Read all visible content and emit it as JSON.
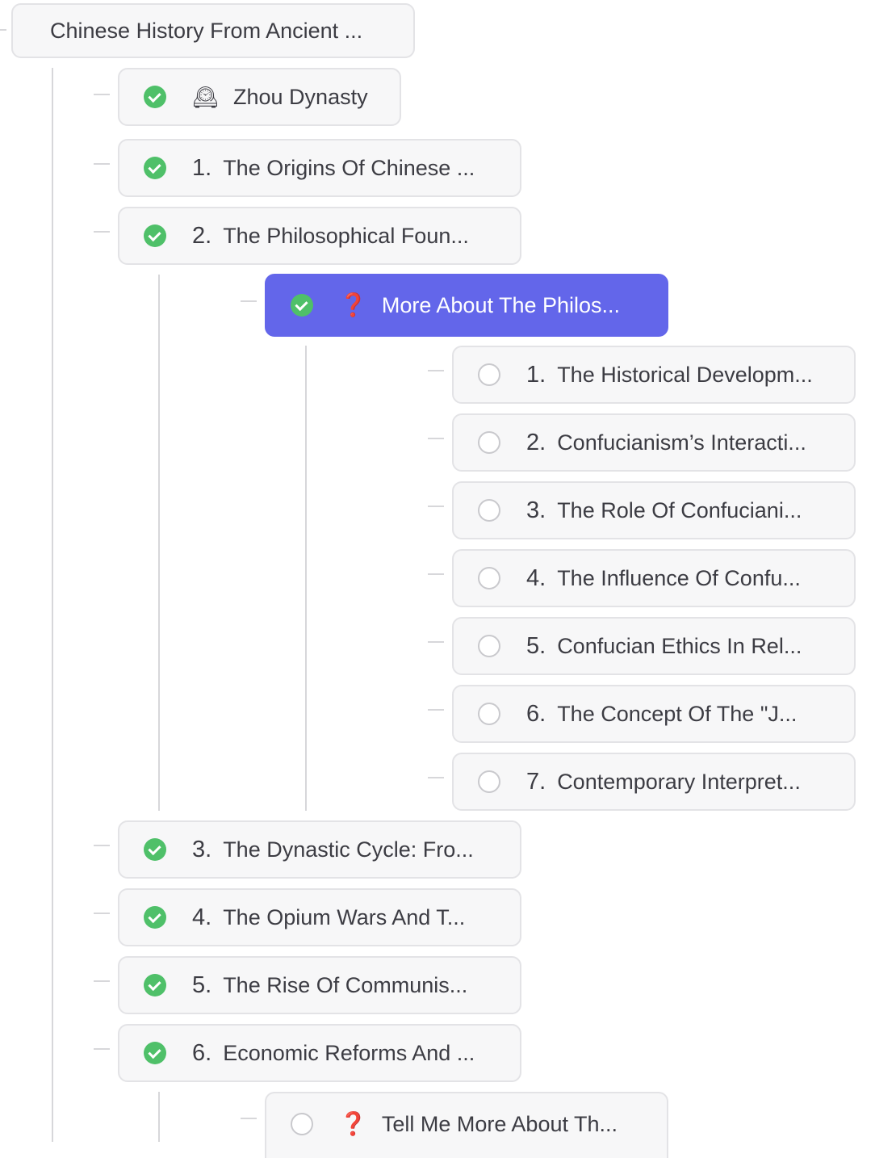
{
  "root": {
    "label": "Chinese History From Ancient ..."
  },
  "level1_top": [
    {
      "status": "done",
      "icon": "mantelpiece-clock-icon",
      "glyph": "🕰",
      "title": "Zhou Dynasty"
    },
    {
      "status": "done",
      "number": "1.",
      "title": "The Origins Of Chinese ..."
    },
    {
      "status": "done",
      "number": "2.",
      "title": "The Philosophical Foun..."
    }
  ],
  "level2_active": {
    "status": "done",
    "icon": "question-mark-icon",
    "glyph": "❓",
    "title": "More About The Philos..."
  },
  "level3": [
    {
      "status": "todo",
      "number": "1.",
      "title": "The Historical Developm..."
    },
    {
      "status": "todo",
      "number": "2.",
      "title": "Confucianism’s Interacti..."
    },
    {
      "status": "todo",
      "number": "3.",
      "title": "The Role Of Confuciani..."
    },
    {
      "status": "todo",
      "number": "4.",
      "title": "The Influence Of Confu..."
    },
    {
      "status": "todo",
      "number": "5.",
      "title": "Confucian Ethics In Rel..."
    },
    {
      "status": "todo",
      "number": "6.",
      "title": "The Concept Of The \"J..."
    },
    {
      "status": "todo",
      "number": "7.",
      "title": "Contemporary Interpret..."
    }
  ],
  "level1_bottom": [
    {
      "status": "done",
      "number": "3.",
      "title": "The Dynastic Cycle: Fro..."
    },
    {
      "status": "done",
      "number": "4.",
      "title": "The Opium Wars And T..."
    },
    {
      "status": "done",
      "number": "5.",
      "title": "The Rise Of Communis..."
    },
    {
      "status": "done",
      "number": "6.",
      "title": "Economic Reforms And ..."
    }
  ],
  "level2_bottom": {
    "status": "todo",
    "icon": "question-mark-icon",
    "glyph": "❓",
    "title": "Tell Me More About Th..."
  },
  "colors": {
    "accent": "#6366ea",
    "done": "#4fc069",
    "node_bg": "#f7f7f8",
    "border": "#e3e3e6"
  }
}
